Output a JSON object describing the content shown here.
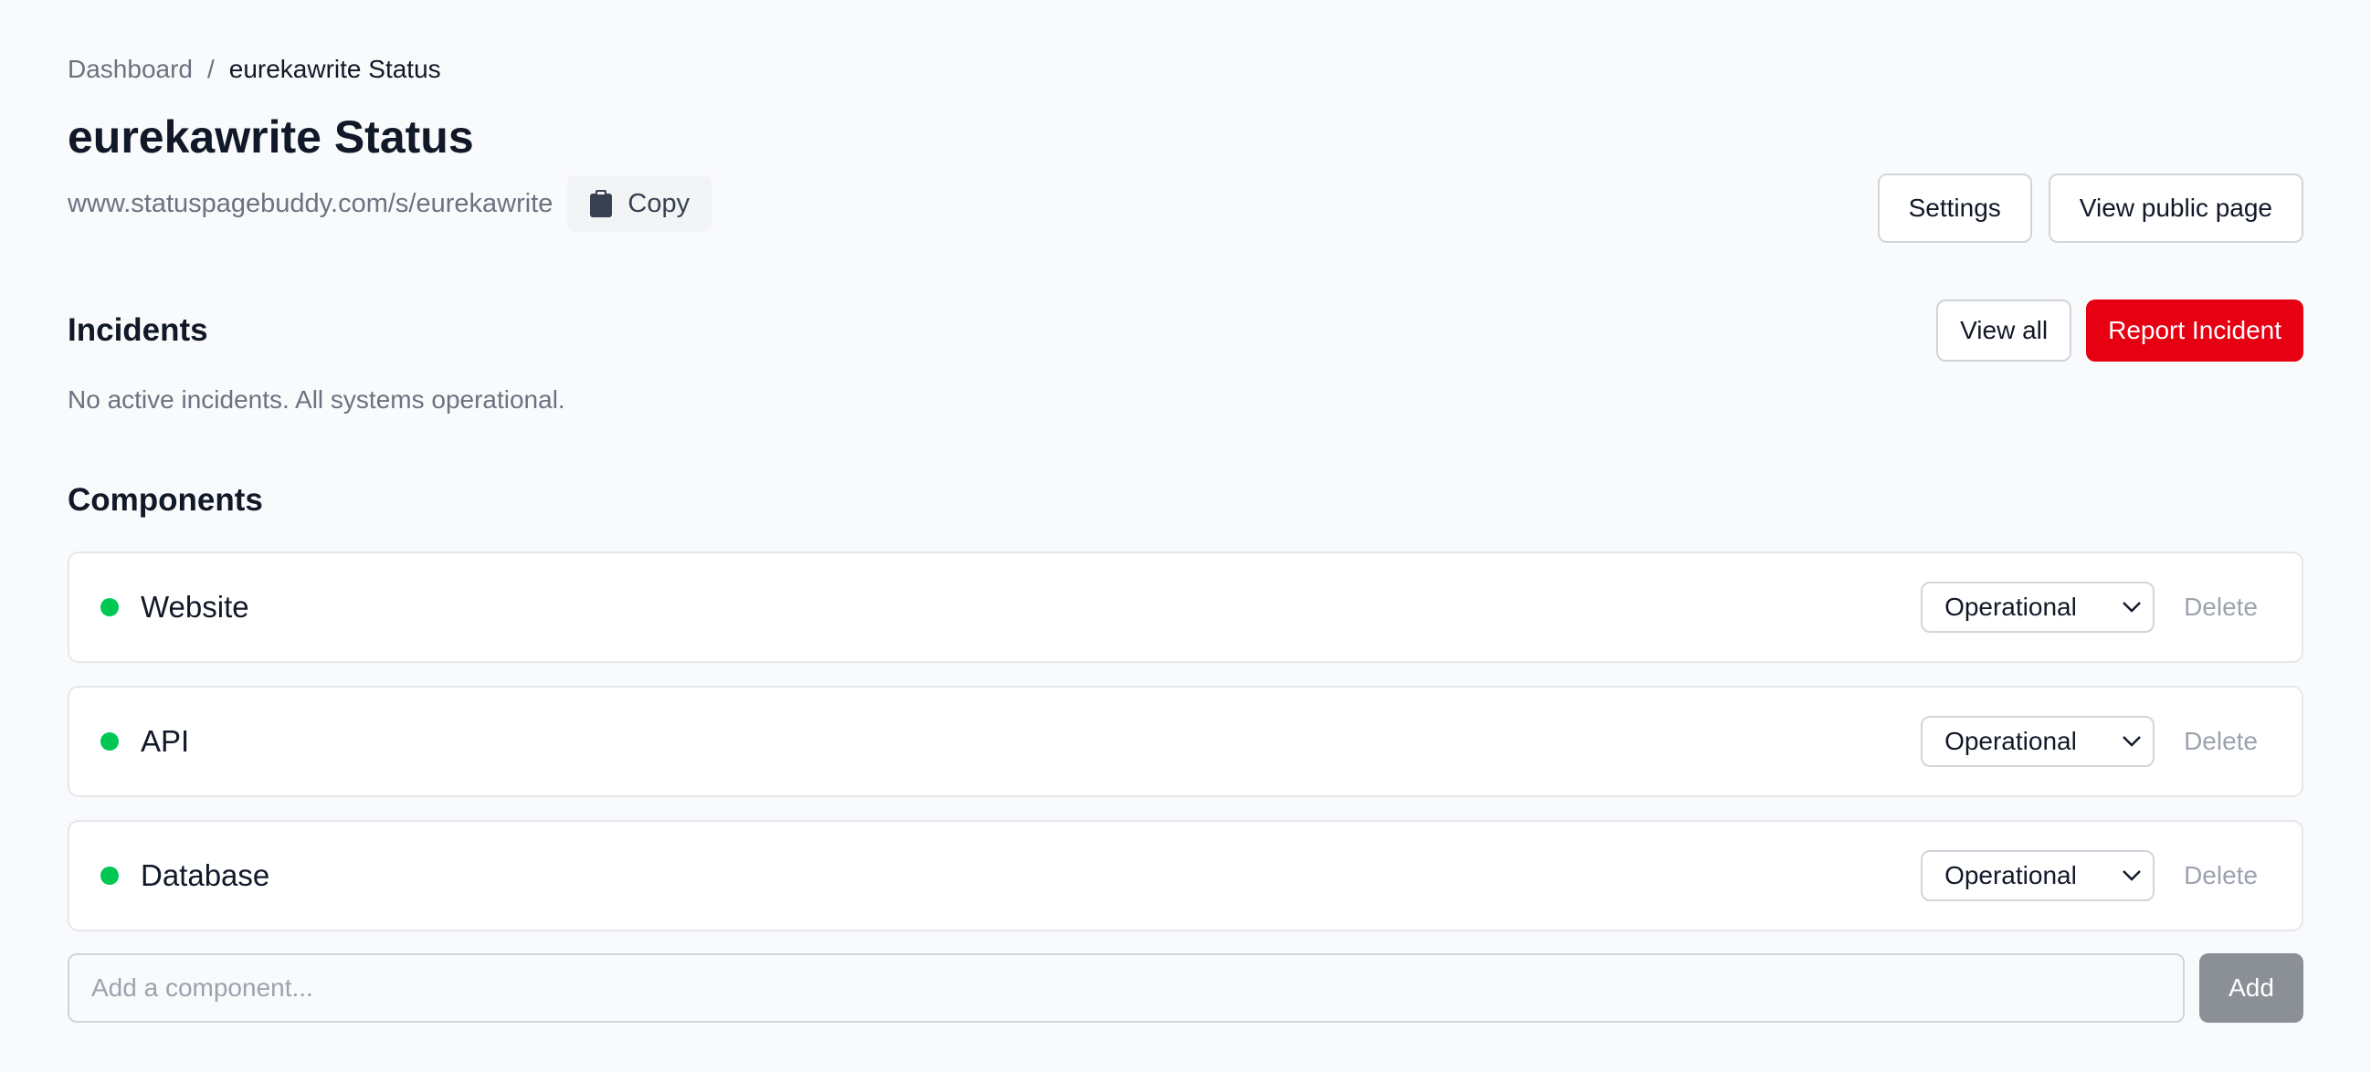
{
  "breadcrumb": {
    "parent": "Dashboard",
    "separator": "/",
    "current": "eurekawrite Status"
  },
  "header": {
    "title": "eurekawrite Status",
    "url": "www.statuspagebuddy.com/s/eurekawrite",
    "copy_label": "Copy",
    "copy_icon": "clipboard-icon",
    "settings_label": "Settings",
    "view_public_label": "View public page"
  },
  "incidents": {
    "title": "Incidents",
    "view_all_label": "View all",
    "report_label": "Report Incident",
    "empty_message": "No active incidents. All systems operational."
  },
  "components": {
    "title": "Components",
    "items": [
      {
        "name": "Website",
        "status": "Operational",
        "delete_label": "Delete"
      },
      {
        "name": "API",
        "status": "Operational",
        "delete_label": "Delete"
      },
      {
        "name": "Database",
        "status": "Operational",
        "delete_label": "Delete"
      }
    ],
    "add_placeholder": "Add a component...",
    "add_label": "Add"
  },
  "colors": {
    "operational": "#00c853",
    "danger": "#e60012",
    "add_button": "#8b8f96"
  }
}
